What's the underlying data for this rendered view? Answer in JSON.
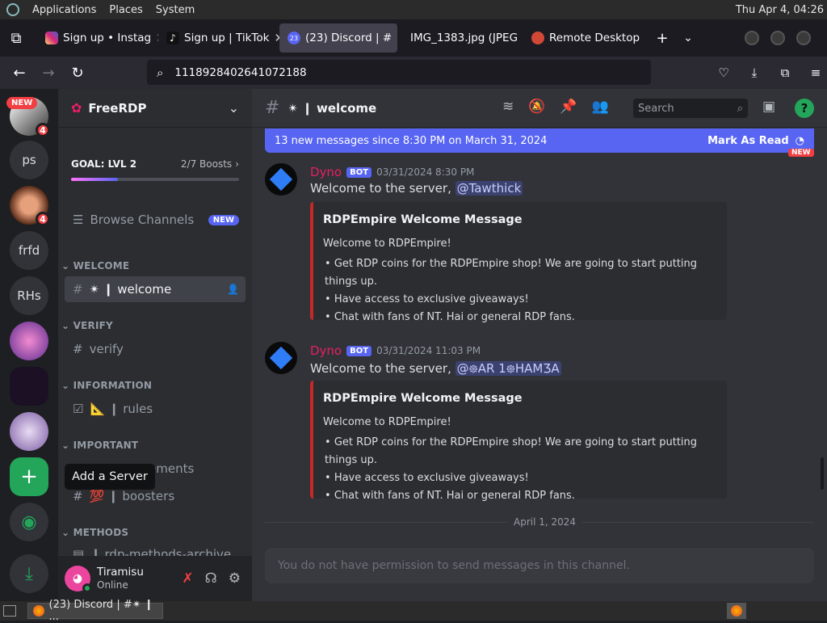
{
  "os": {
    "menu": [
      "Applications",
      "Places",
      "System"
    ],
    "clock": "Thu Apr  4, 04:26"
  },
  "browser": {
    "tabs": [
      {
        "label": "Sign up • Instag",
        "favicon_color": "#e1306c"
      },
      {
        "label": "Sign up | TikTok",
        "favicon_color": "#000000"
      },
      {
        "label": "(23) Discord | #",
        "favicon_color": "#5865f2",
        "badge": "23"
      },
      {
        "label": "IMG_1383.jpg (JPEG",
        "favicon_color": "#2b2a33"
      },
      {
        "label": "Remote Desktop",
        "favicon_color": "#d14836"
      }
    ],
    "url": "1118928402641072188"
  },
  "servers": [
    {
      "label": "",
      "badge": "4",
      "new": "NEW"
    },
    {
      "label": "ps"
    },
    {
      "label": "",
      "badge": "4"
    },
    {
      "label": "frfd"
    },
    {
      "label": "RHs"
    },
    {
      "label": ""
    },
    {
      "label": ""
    },
    {
      "label": ""
    },
    {
      "label": "+"
    },
    {
      "label": ""
    },
    {
      "label": ""
    }
  ],
  "tooltip": {
    "text": "Add a Server"
  },
  "server": {
    "name": "FreeRDP",
    "goal": "GOAL: LVL 2",
    "boosts": "2/7 Boosts",
    "browse_channels": "Browse Channels",
    "browse_badge": "NEW",
    "categories": [
      "WELCOME",
      "VERIFY",
      "INFORMATION",
      "IMPORTANT",
      "METHODS"
    ],
    "channels": {
      "welcome": "✴ ❙ welcome",
      "verify": "verify",
      "rules": "📐 ❙ rules",
      "announcements": "ements",
      "boosters": "💯 ❙ boosters",
      "methods": "❙ rdp-methods-archive"
    }
  },
  "user": {
    "name": "Tiramisu",
    "status": "Online"
  },
  "channel_header": {
    "title": "✴ ❙ welcome",
    "search_placeholder": "Search"
  },
  "banner": {
    "text": "13 new messages since 8:30 PM on March 31, 2024",
    "action": "Mark As Read"
  },
  "messages": [
    {
      "author": "Dyno",
      "bot": "BOT",
      "timestamp": "03/31/2024 8:30 PM",
      "text": "Welcome to the server,",
      "mention": "@Tawthick",
      "embed": {
        "title": "RDPEmpire Welcome Message",
        "intro": "Welcome to RDPEmpire!",
        "bullets": [
          "Get RDP coins for the RDPEmpire shop! We are going to start putting things up.",
          "Have access to exclusive giveaways!",
          "Chat with fans of NT. Hai or general RDP fans."
        ]
      }
    },
    {
      "author": "Dyno",
      "bot": "BOT",
      "timestamp": "03/31/2024 11:03 PM",
      "text": "Welcome to the server,",
      "mention": "@᪥AR 1᪥HAMƷA",
      "embed": {
        "title": "RDPEmpire Welcome Message",
        "intro": "Welcome to RDPEmpire!",
        "bullets": [
          "Get RDP coins for the RDPEmpire shop! We are going to start putting things up.",
          "Have access to exclusive giveaways!",
          "Chat with fans of NT. Hai or general RDP fans."
        ]
      }
    }
  ],
  "date_divider": "April 1, 2024",
  "composer": {
    "placeholder": "You do not have permission to send messages in this channel."
  },
  "taskbar": {
    "task": "(23) Discord | #✴ ❙ ..."
  },
  "new_pill": "NEW"
}
